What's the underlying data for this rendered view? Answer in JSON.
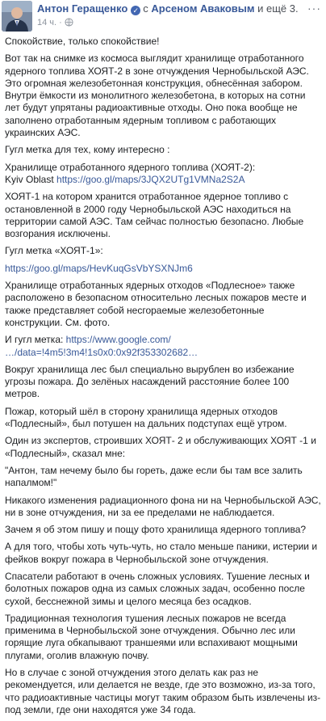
{
  "header": {
    "author": "Антон Геращенко",
    "with_prefix": "с",
    "with_name": "Арсеном Аваковым",
    "with_suffix": "и ещё 3.",
    "time": "14 ч.",
    "more_label": "···"
  },
  "paragraphs": [
    {
      "text": "Спокойствие, только спокойствие!"
    },
    {
      "text": "Вот так на снимке из космоса выглядит хранилище отработанного ядерного топлива ХОЯТ-2 в зоне отчуждения Чернобыльской АЭС. Это огромная железобетонная конструкция, обнесённая забором. Внутри ёмкости из монолитного железобетона, в которых на сотни лет будут упрятаны радиоактивные отходы. Оно пока вообще не заполнено отработанным ядерным топливом с работающих украинских АЭС."
    },
    {
      "text": "Гугл метка для тех, кому интересно :"
    },
    {
      "text": "Хранилище отработанного ядерного топлива (ХОЯТ-2):",
      "line2_prefix": "Kyiv Oblast",
      "link": "https://goo.gl/maps/3JQX2UTg1VMNa2S2A"
    },
    {
      "text": "ХОЯТ-1 на котором хранится отработанное ядерное топливо с остановленной в 2000 году Чернобыльской АЭС находиться на территории самой АЭС. Там сейчас полностью безопасно. Любые возгорания исключены."
    },
    {
      "text": "Гугл метка «ХОЯТ-1»:"
    },
    {
      "link": "https://goo.gl/maps/HevKuqGsVbYSXNJm6"
    },
    {
      "text": "Хранилище отработанных ядерных отходов «Подлесное» также расположено в безопасном относительно лесных пожаров месте и также представляет собой несгораемые железобетонные конструкции. См. фото."
    },
    {
      "text": "И гугл метка:",
      "link": "https://www.google.com/",
      "link2": "…/data=!4m5!3m4!1s0x0:0x92f353302682…"
    },
    {
      "text": "Вокруг хранилища лес был специально вырублен во избежание угрозы пожара. До зелёных насаждений расстояние более 100 метров."
    },
    {
      "text": "Пожар, который шёл в сторону хранилища ядерных отходов «Подлесный», был потушен на дальних подступах ещё утром."
    },
    {
      "text": "Один из экспертов, строивших ХОЯТ- 2 и обслуживающих ХОЯТ -1 и «Подлесный», сказал мне:"
    },
    {
      "text": "\"Антон, там нечему было бы гореть, даже если бы там все залить напалмом!\""
    },
    {
      "text": "Никакого изменения радиационного фона ни на Чернобыльской АЭС, ни в зоне отчуждения, ни за ее пределами не наблюдается."
    },
    {
      "text": "Зачем я об этом пишу и пощу фото хранилища ядерного топлива?"
    },
    {
      "text": "А для того, чтобы хоть чуть-чуть, но стало меньше паники, истерии и фейков вокруг пожара в Чернобыльской зоне отчуждения."
    },
    {
      "text": "Спасатели работают в очень сложных условиях. Тушение лесных и болотных пожаров одна из самых сложных задач, особенно после сухой, бесснежной зимы и целого месяца без осадков."
    },
    {
      "text": "Традиционная технология тушения лесных пожаров не всегда применима в Чернобыльской зоне отчуждения. Обычно лес или горящие луга обкапывают траншеями или вспахивают мощными плугами, оголив влажную почву."
    },
    {
      "text": "Но в случае с зоной отчуждения этого делать как раз не рекомендуется, или делается не везде, где это возможно, из-за того, что радиоактивные частицы могут таким образом быть извлечены из-под земли, где они находятся уже 34 года."
    }
  ]
}
